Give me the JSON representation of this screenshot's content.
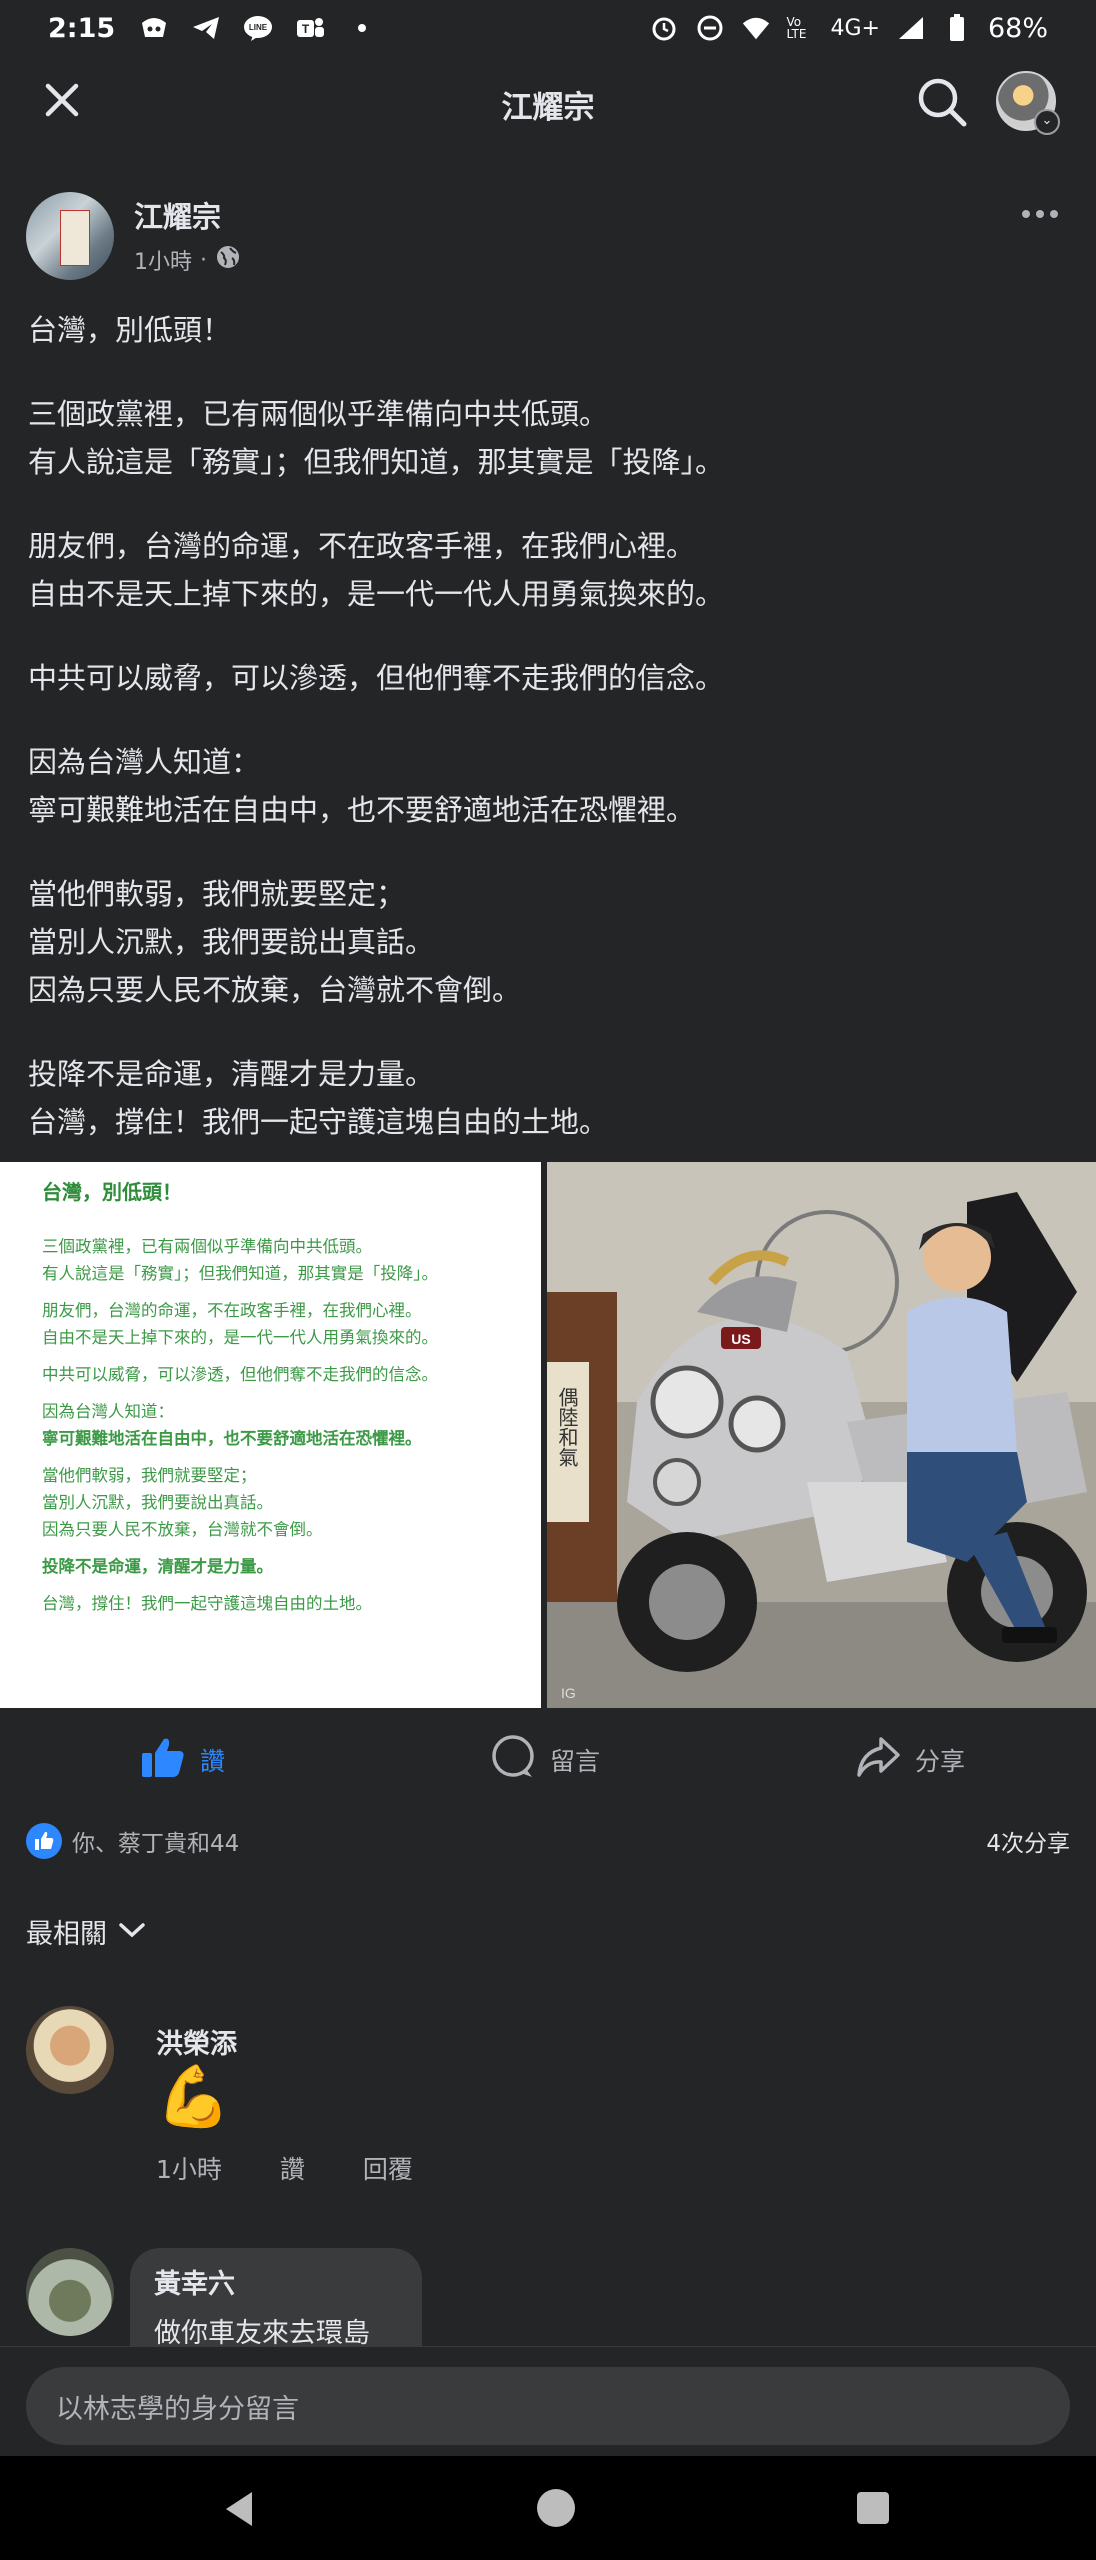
{
  "status_bar": {
    "time": "2:15",
    "battery": "68%",
    "network": "4G+",
    "volte": "Vo LTE",
    "icons": [
      "app-icon",
      "telegram-icon",
      "line-icon",
      "teams-icon",
      "dot-icon",
      "alarm-icon",
      "dnd-icon",
      "wifi-icon",
      "signal-icon",
      "battery-icon"
    ]
  },
  "header": {
    "title": "江耀宗",
    "close_icon": "close-icon",
    "search_icon": "search-icon",
    "profile_badge": "⌄"
  },
  "post": {
    "author": "江耀宗",
    "time": "1小時",
    "separator": "·",
    "privacy_icon": "globe-icon",
    "paragraphs": [
      [
        "台灣，別低頭！"
      ],
      [
        "三個政黨裡，已有兩個似乎準備向中共低頭。",
        "有人說這是「務實」；但我們知道，那其實是「投降」。"
      ],
      [
        "朋友們，台灣的命運，不在政客手裡，在我們心裡。",
        "自由不是天上掉下來的，是一代一代人用勇氣換來的。"
      ],
      [
        "中共可以威脅，可以滲透，但他們奪不走我們的信念。"
      ],
      [
        "因為台灣人知道：",
        "寧可艱難地活在自由中，也不要舒適地活在恐懼裡。"
      ],
      [
        "當他們軟弱，我們就要堅定；",
        "當別人沉默，我們要說出真話。",
        "因為只要人民不放棄，台灣就不會倒。"
      ],
      [
        "投降不是命運，清醒才是力量。",
        "台灣，撐住！我們一起守護這塊自由的土地。"
      ]
    ],
    "image_text": {
      "title": "台灣，別低頭！",
      "lines": [
        {
          "text": "三個政黨裡，已有兩個似乎準備向中共低頭。",
          "bold": false
        },
        {
          "text": "有人說這是「務實」；但我們知道，那其實是「投降」。",
          "bold": false
        },
        {
          "text": "",
          "bold": false
        },
        {
          "text": "朋友們，台灣的命運，不在政客手裡，在我們心裡。",
          "bold": false
        },
        {
          "text": "自由不是天上掉下來的，是一代一代人用勇氣換來的。",
          "bold": false
        },
        {
          "text": "",
          "bold": false
        },
        {
          "text": "中共可以威脅，可以滲透，但他們奪不走我們的信念。",
          "bold": false
        },
        {
          "text": "",
          "bold": false
        },
        {
          "text": "因為台灣人知道：",
          "bold": false
        },
        {
          "text": "寧可艱難地活在自由中，也不要舒適地活在恐懼裡。",
          "bold": true
        },
        {
          "text": "",
          "bold": false
        },
        {
          "text": "當他們軟弱，我們就要堅定；",
          "bold": false
        },
        {
          "text": "當別人沉默，我們要說出真話。",
          "bold": false
        },
        {
          "text": "因為只要人民不放棄，台灣就不會倒。",
          "bold": false
        },
        {
          "text": "",
          "bold": false
        },
        {
          "text": "投降不是命運，清醒才是力量。",
          "bold": true
        },
        {
          "text": "",
          "bold": false
        },
        {
          "text": "台灣，撐住！我們一起守護這塊自由的土地。",
          "bold": false
        }
      ]
    },
    "photo": {
      "calligraphy": "偶陸和氣",
      "plate_badge": "US"
    }
  },
  "actions": {
    "like": "讚",
    "comment": "留言",
    "share": "分享",
    "like_color": "#2d88ff"
  },
  "reactions": {
    "text": "你、蔡丁貴和44",
    "shares": "4次分享"
  },
  "sort": {
    "label": "最相關"
  },
  "comments": [
    {
      "name": "洪榮添",
      "content": "💪",
      "time": "1小時",
      "like": "讚",
      "reply": "回覆"
    },
    {
      "name": "黃幸六",
      "content": "做你車友來去環島"
    }
  ],
  "composer": {
    "placeholder": "以林志學的身分留言"
  },
  "nav": {
    "back_icon": "back-triangle-icon",
    "home_icon": "home-circle-icon",
    "recent_icon": "recent-square-icon"
  }
}
